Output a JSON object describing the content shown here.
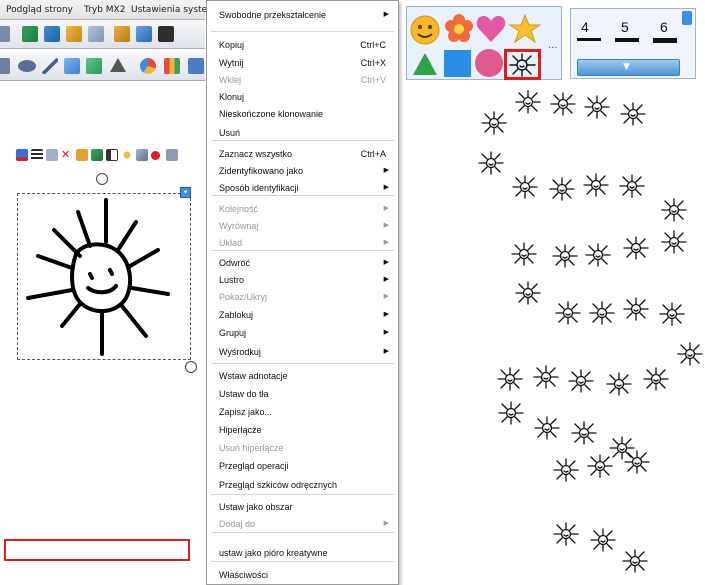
{
  "menubar": {
    "items": [
      "Podgląd strony",
      "Tryb MX2",
      "Ustawienia syste"
    ]
  },
  "context_menu": {
    "items": [
      {
        "label": "Swobodne przekształcenie",
        "shortcut": "",
        "submenu": true,
        "disabled": false
      },
      {
        "label": "Kopiuj",
        "shortcut": "Ctrl+C",
        "submenu": false,
        "disabled": false
      },
      {
        "label": "Wytnij",
        "shortcut": "Ctrl+X",
        "submenu": false,
        "disabled": false
      },
      {
        "label": "Wklej",
        "shortcut": "Ctrl+V",
        "submenu": false,
        "disabled": true
      },
      {
        "label": "Klonuj",
        "shortcut": "",
        "submenu": false,
        "disabled": false
      },
      {
        "label": "Nieskończone klonowanie",
        "shortcut": "",
        "submenu": false,
        "disabled": false
      },
      {
        "label": "Usuń",
        "shortcut": "",
        "submenu": false,
        "disabled": false
      },
      {
        "label": "Zaznacz wszystko",
        "shortcut": "Ctrl+A",
        "submenu": false,
        "disabled": false
      },
      {
        "label": "Zidentyfikowano jako",
        "shortcut": "",
        "submenu": true,
        "disabled": false
      },
      {
        "label": "Sposób identyfikacji",
        "shortcut": "",
        "submenu": true,
        "disabled": false
      },
      {
        "label": "Kolejność",
        "shortcut": "",
        "submenu": true,
        "disabled": true
      },
      {
        "label": "Wyrównaj",
        "shortcut": "",
        "submenu": true,
        "disabled": true
      },
      {
        "label": "Układ",
        "shortcut": "",
        "submenu": true,
        "disabled": true
      },
      {
        "label": "Odwróć",
        "shortcut": "",
        "submenu": true,
        "disabled": false
      },
      {
        "label": "Lustro",
        "shortcut": "",
        "submenu": true,
        "disabled": false
      },
      {
        "label": "Pokaż/Ukryj",
        "shortcut": "",
        "submenu": true,
        "disabled": true
      },
      {
        "label": "Zablokuj",
        "shortcut": "",
        "submenu": true,
        "disabled": false
      },
      {
        "label": "Grupuj",
        "shortcut": "",
        "submenu": true,
        "disabled": false
      },
      {
        "label": "Wyśrodkuj",
        "shortcut": "",
        "submenu": true,
        "disabled": false
      },
      {
        "label": "Wstaw adnotacje",
        "shortcut": "",
        "submenu": false,
        "disabled": false
      },
      {
        "label": "Ustaw do tła",
        "shortcut": "",
        "submenu": false,
        "disabled": false
      },
      {
        "label": "Zapisz jako...",
        "shortcut": "",
        "submenu": false,
        "disabled": false
      },
      {
        "label": "Hiperłącze",
        "shortcut": "",
        "submenu": false,
        "disabled": false
      },
      {
        "label": "Usuń hiperłącze",
        "shortcut": "",
        "submenu": false,
        "disabled": true
      },
      {
        "label": "Przegląd operacji",
        "shortcut": "",
        "submenu": false,
        "disabled": false
      },
      {
        "label": "Przegląd szkiców odręcznych",
        "shortcut": "",
        "submenu": false,
        "disabled": false
      },
      {
        "label": "Ustaw jako obszar",
        "shortcut": "",
        "submenu": false,
        "disabled": false
      },
      {
        "label": "Dodaj do",
        "shortcut": "",
        "submenu": true,
        "disabled": true
      },
      {
        "label": "ustaw jako pióro kreatywne",
        "shortcut": "",
        "submenu": false,
        "disabled": false
      },
      {
        "label": "Właściwości",
        "shortcut": "",
        "submenu": false,
        "disabled": false
      }
    ]
  },
  "shape_gallery": {
    "icons": [
      "smiley-icon",
      "flower-icon",
      "heart-icon",
      "star-icon",
      "triangle-icon",
      "square-icon",
      "circle-icon",
      "sun-stamp-icon"
    ],
    "more": "..."
  },
  "pen_width": {
    "options": [
      "4",
      "5",
      "6"
    ]
  },
  "colors": {
    "highlight": "#e31b1b",
    "accent": "#3a8ee6"
  },
  "canvas": {
    "stamp_icon": "sun-stamp-icon"
  }
}
